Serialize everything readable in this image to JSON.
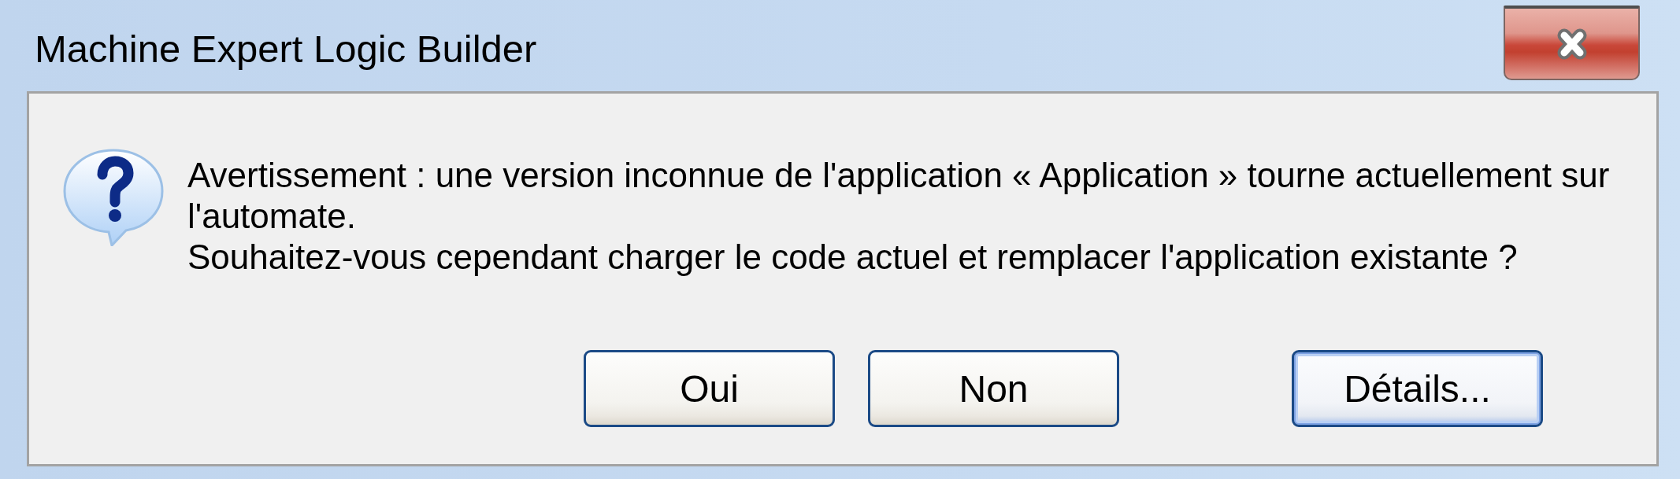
{
  "window": {
    "title": "Machine Expert Logic Builder"
  },
  "message": {
    "paragraphs": [
      "Avertissement : une version inconnue de l'application « Application » tourne actuellement sur l'automate.",
      "Souhaitez-vous cependant charger le code actuel et remplacer l'application existante ?"
    ]
  },
  "buttons": [
    {
      "label": "Oui",
      "default": false
    },
    {
      "label": "Non",
      "default": false
    },
    {
      "label": "Détails...",
      "default": true
    }
  ]
}
